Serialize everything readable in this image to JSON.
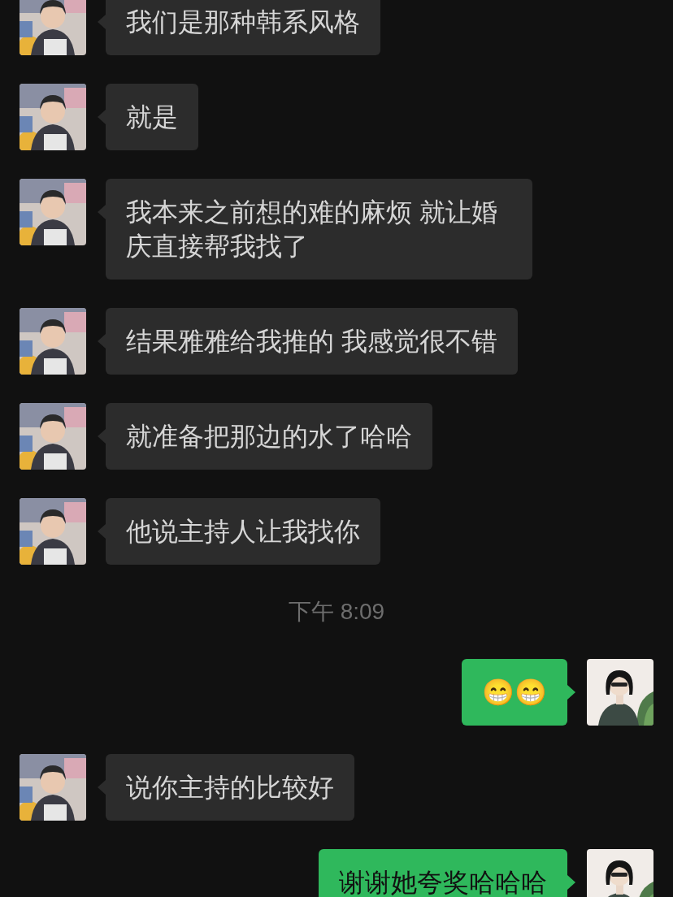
{
  "messages": [
    {
      "kind": "received",
      "text": "我们是那种韩系风格"
    },
    {
      "kind": "received",
      "text": "就是"
    },
    {
      "kind": "received",
      "text": "我本来之前想的难的麻烦 就让婚庆直接帮我找了"
    },
    {
      "kind": "received",
      "text": "结果雅雅给我推的 我感觉很不错"
    },
    {
      "kind": "received",
      "text": "就准备把那边的水了哈哈"
    },
    {
      "kind": "received",
      "text": "他说主持人让我找你"
    },
    {
      "kind": "time",
      "text": "下午 8:09"
    },
    {
      "kind": "sent",
      "text": "😁😁"
    },
    {
      "kind": "received",
      "text": "说你主持的比较好"
    },
    {
      "kind": "sent",
      "text": "谢谢她夸奖哈哈哈"
    }
  ]
}
